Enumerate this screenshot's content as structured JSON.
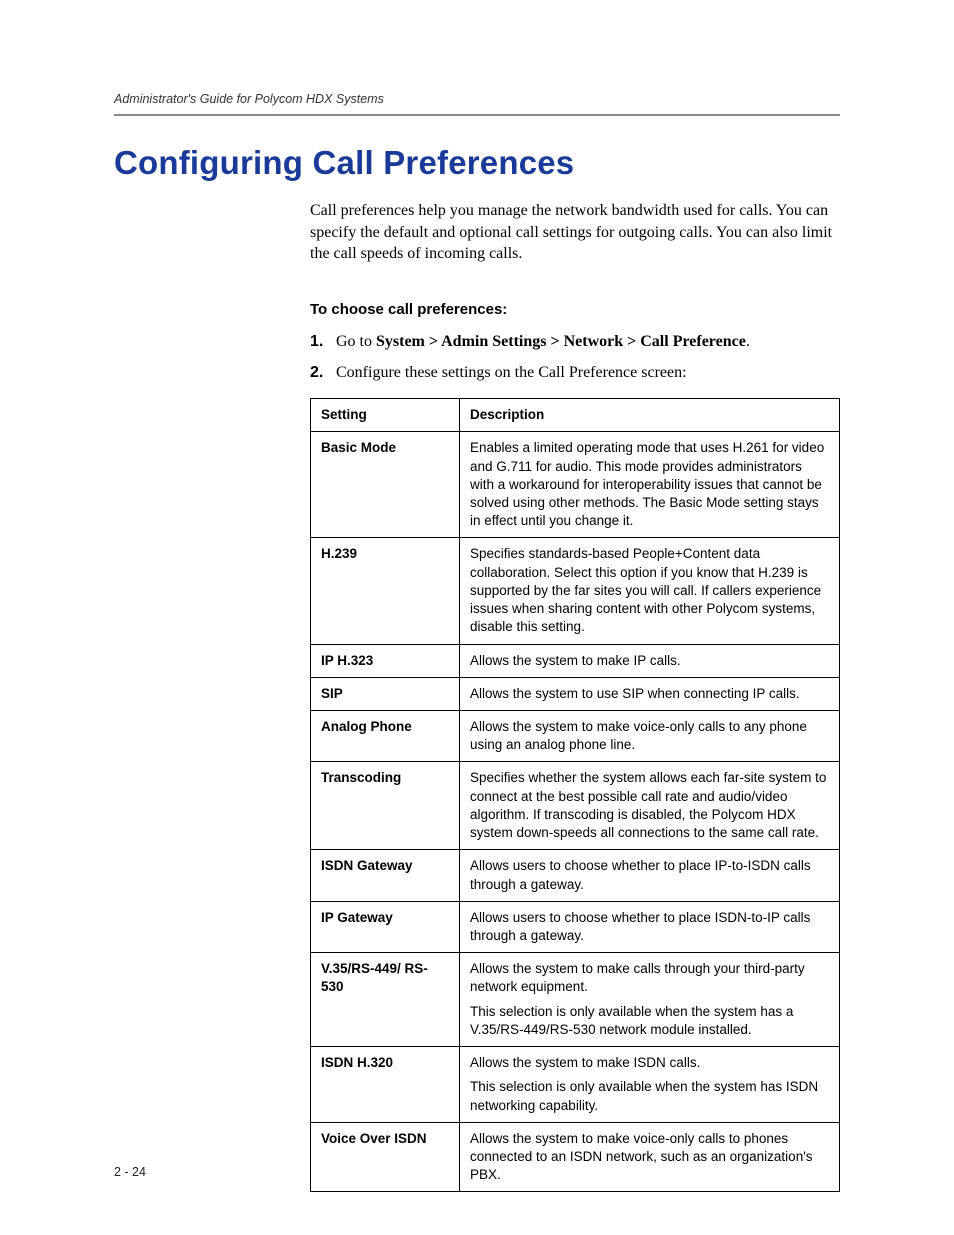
{
  "header": {
    "running_title": "Administrator's Guide for Polycom HDX Systems"
  },
  "title": "Configuring Call Preferences",
  "intro": "Call preferences help you manage the network bandwidth used for calls. You can specify the default and optional call settings for outgoing calls. You can also limit the call speeds of incoming calls.",
  "procedure_heading": "To choose call preferences:",
  "steps": [
    {
      "num": "1.",
      "prefix": "Go to ",
      "strong": "System > Admin Settings > Network > Call Preference",
      "suffix": "."
    },
    {
      "num": "2.",
      "prefix": "Configure these settings on the Call Preference screen:",
      "strong": "",
      "suffix": ""
    }
  ],
  "table": {
    "head_setting": "Setting",
    "head_description": "Description",
    "rows": [
      {
        "setting": "Basic Mode",
        "desc": [
          "Enables a limited operating mode that uses H.261 for video and G.711 for audio. This mode provides administrators with a workaround for interoperability issues that cannot be solved using other methods. The Basic Mode setting stays in effect until you change it."
        ]
      },
      {
        "setting": "H.239",
        "desc": [
          "Specifies standards-based People+Content data collaboration. Select this option if you know that H.239 is supported by the far sites you will call. If callers experience issues when sharing content with other Polycom systems, disable this setting."
        ]
      },
      {
        "setting": "IP H.323",
        "desc": [
          "Allows the system to make IP calls."
        ]
      },
      {
        "setting": "SIP",
        "desc": [
          "Allows the system to use SIP when connecting IP calls."
        ]
      },
      {
        "setting": "Analog Phone",
        "desc": [
          "Allows the system to make voice-only calls to any phone using an analog phone line."
        ]
      },
      {
        "setting": "Transcoding",
        "desc": [
          "Specifies whether the system allows each far-site system to connect at the best possible call rate and audio/video algorithm. If transcoding is disabled, the Polycom HDX system down-speeds all connections to the same call rate."
        ]
      },
      {
        "setting": "ISDN Gateway",
        "desc": [
          "Allows users to choose whether to place IP-to-ISDN calls through a gateway."
        ]
      },
      {
        "setting": "IP Gateway",
        "desc": [
          "Allows users to choose whether to place ISDN-to-IP calls through a gateway."
        ]
      },
      {
        "setting": "V.35/RS-449/ RS-530",
        "desc": [
          "Allows the system to make calls through your third-party network equipment.",
          "This selection is only available when the system has a V.35/RS-449/RS-530 network module installed."
        ]
      },
      {
        "setting": "ISDN H.320",
        "desc": [
          "Allows the system to make ISDN calls.",
          "This selection is only available when the system has ISDN networking capability."
        ]
      },
      {
        "setting": "Voice Over ISDN",
        "desc": [
          "Allows the system to make voice-only calls to phones connected to an ISDN network, such as an organization's PBX."
        ]
      }
    ]
  },
  "footer": "2 - 24"
}
